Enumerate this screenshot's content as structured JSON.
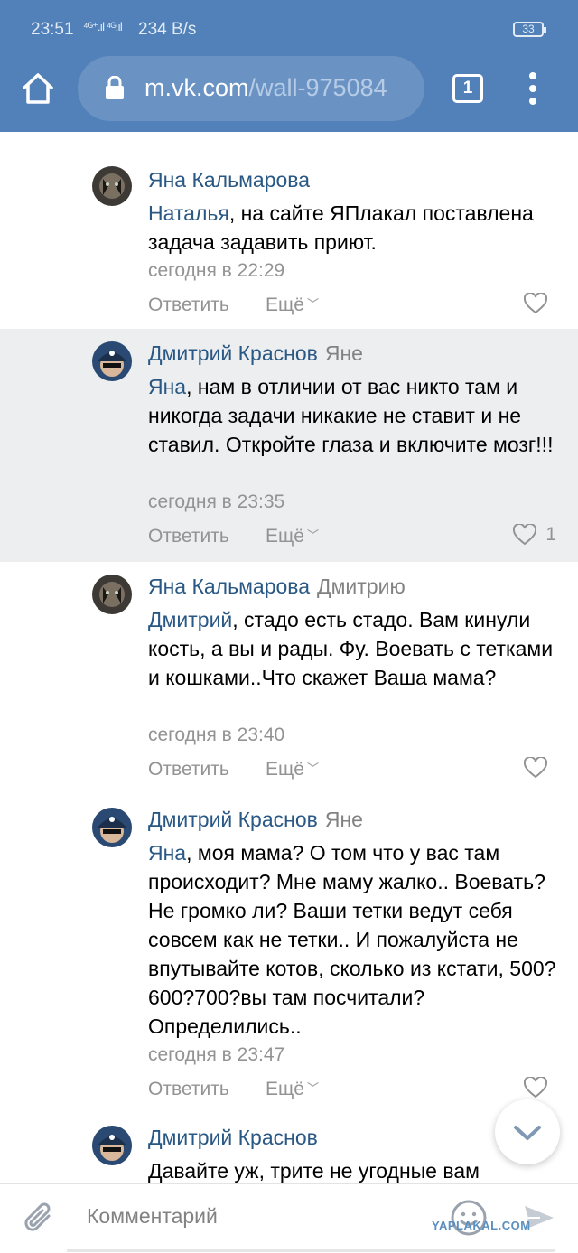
{
  "status_bar": {
    "time": "23:51",
    "signal": "⁴ᴳ⁺.ıl ⁴ᴳ.ıl",
    "net_speed": "234 B/s",
    "battery": "33"
  },
  "browser": {
    "url_host": "m.vk.com",
    "url_path": "/wall-975084",
    "tab_count": "1"
  },
  "comments": [
    {
      "author": "Яна Кальмарова",
      "reply_to": "",
      "mention": "Наталья",
      "text": ", на сайте ЯПлакал поставлена задача задавить приют.",
      "date": "сегодня в 22:29",
      "reply_label": "Ответить",
      "more_label": "Ещё",
      "likes": ""
    },
    {
      "author": "Дмитрий Краснов",
      "reply_to": "Яне",
      "mention": "Яна",
      "text": ", нам в отличии от вас никто там и никогда задачи никакие не ставит и не ставил. Откройте глаза и включите мозг!!!",
      "date": "сегодня в 23:35",
      "reply_label": "Ответить",
      "more_label": "Ещё",
      "likes": "1"
    },
    {
      "author": "Яна Кальмарова",
      "reply_to": "Дмитрию",
      "mention": "Дмитрий",
      "text": ", стадо есть стадо. Вам кинули кость, а вы и рады. Фу. Воевать с тетками и кошками..Что скажет Ваша мама?",
      "date": "сегодня в 23:40",
      "reply_label": "Ответить",
      "more_label": "Ещё",
      "likes": ""
    },
    {
      "author": "Дмитрий Краснов",
      "reply_to": "Яне",
      "mention": "Яна",
      "text": ", моя мама? О том что у вас там происходит? Мне маму жалко.. Воевать? Не громко ли? Ваши тетки ведут себя совсем как не тетки.. И пожалуйста не впутывайте котов, сколько из кстати, 500?600?700?вы там посчитали? Определились..",
      "date": "сегодня в 23:47",
      "reply_label": "Ответить",
      "more_label": "Ещё",
      "likes": ""
    },
    {
      "author": "Дмитрий Краснов",
      "reply_to": "",
      "mention": "",
      "text": "Давайте уж, трите не угодные вам",
      "date": "",
      "reply_label": "",
      "more_label": "",
      "likes": ""
    }
  ],
  "composer": {
    "placeholder": "Комментарий"
  },
  "watermark": "YAPLAKAL.COM",
  "colors": {
    "header": "#5181b8",
    "link": "#2a5885",
    "meta": "#939393",
    "highlight": "#edeef0"
  }
}
